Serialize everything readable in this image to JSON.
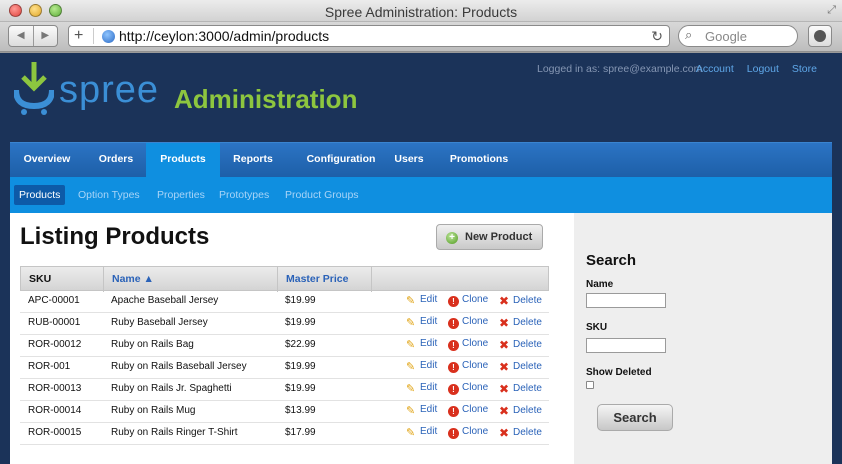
{
  "window": {
    "title": "Spree Administration: Products"
  },
  "browser": {
    "url": "http://ceylon:3000/admin/products",
    "search_placeholder": "Google"
  },
  "header": {
    "logo_text": "spree",
    "admin_title": "Administration",
    "logged_in": "Logged in as: spree@example.com",
    "links": [
      "Account",
      "Logout",
      "Store"
    ]
  },
  "main_nav": [
    "Overview",
    "Orders",
    "Products",
    "Reports",
    "Configuration",
    "Users",
    "Promotions"
  ],
  "sub_nav": [
    "Products",
    "Option Types",
    "Properties",
    "Prototypes",
    "Product Groups"
  ],
  "listing": {
    "title": "Listing Products",
    "new_button": "New Product",
    "headers": {
      "sku": "SKU",
      "name": "Name ▲",
      "price": "Master Price"
    },
    "actions": {
      "edit": "Edit",
      "clone": "Clone",
      "delete": "Delete"
    },
    "rows": [
      {
        "sku": "APC-00001",
        "name": "Apache Baseball Jersey",
        "price": "$19.99"
      },
      {
        "sku": "RUB-00001",
        "name": "Ruby Baseball Jersey",
        "price": "$19.99"
      },
      {
        "sku": "ROR-00012",
        "name": "Ruby on Rails Bag",
        "price": "$22.99"
      },
      {
        "sku": "ROR-001",
        "name": "Ruby on Rails Baseball Jersey",
        "price": "$19.99"
      },
      {
        "sku": "ROR-00013",
        "name": "Ruby on Rails Jr. Spaghetti",
        "price": "$19.99"
      },
      {
        "sku": "ROR-00014",
        "name": "Ruby on Rails Mug",
        "price": "$13.99"
      },
      {
        "sku": "ROR-00015",
        "name": "Ruby on Rails Ringer T-Shirt",
        "price": "$17.99"
      }
    ]
  },
  "sidebar": {
    "title": "Search",
    "name_label": "Name",
    "sku_label": "SKU",
    "show_deleted_label": "Show Deleted",
    "search_button": "Search"
  },
  "colors": {
    "header_bg": "#1b3359",
    "nav_bg": "#1d5fa8",
    "subnav_bg": "#0f8fe0",
    "logo_green": "#8dc63f"
  }
}
